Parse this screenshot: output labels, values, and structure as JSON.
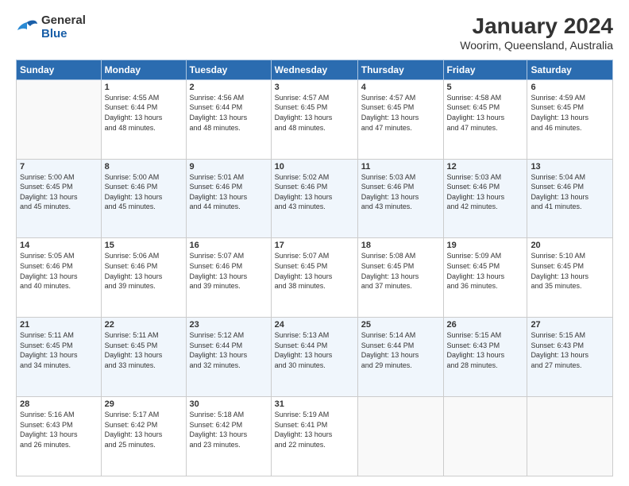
{
  "header": {
    "logo_general": "General",
    "logo_blue": "Blue",
    "title": "January 2024",
    "subtitle": "Woorim, Queensland, Australia"
  },
  "days_of_week": [
    "Sunday",
    "Monday",
    "Tuesday",
    "Wednesday",
    "Thursday",
    "Friday",
    "Saturday"
  ],
  "weeks": [
    [
      {
        "day": "",
        "info": ""
      },
      {
        "day": "1",
        "info": "Sunrise: 4:55 AM\nSunset: 6:44 PM\nDaylight: 13 hours\nand 48 minutes."
      },
      {
        "day": "2",
        "info": "Sunrise: 4:56 AM\nSunset: 6:44 PM\nDaylight: 13 hours\nand 48 minutes."
      },
      {
        "day": "3",
        "info": "Sunrise: 4:57 AM\nSunset: 6:45 PM\nDaylight: 13 hours\nand 48 minutes."
      },
      {
        "day": "4",
        "info": "Sunrise: 4:57 AM\nSunset: 6:45 PM\nDaylight: 13 hours\nand 47 minutes."
      },
      {
        "day": "5",
        "info": "Sunrise: 4:58 AM\nSunset: 6:45 PM\nDaylight: 13 hours\nand 47 minutes."
      },
      {
        "day": "6",
        "info": "Sunrise: 4:59 AM\nSunset: 6:45 PM\nDaylight: 13 hours\nand 46 minutes."
      }
    ],
    [
      {
        "day": "7",
        "info": "Sunrise: 5:00 AM\nSunset: 6:45 PM\nDaylight: 13 hours\nand 45 minutes."
      },
      {
        "day": "8",
        "info": "Sunrise: 5:00 AM\nSunset: 6:46 PM\nDaylight: 13 hours\nand 45 minutes."
      },
      {
        "day": "9",
        "info": "Sunrise: 5:01 AM\nSunset: 6:46 PM\nDaylight: 13 hours\nand 44 minutes."
      },
      {
        "day": "10",
        "info": "Sunrise: 5:02 AM\nSunset: 6:46 PM\nDaylight: 13 hours\nand 43 minutes."
      },
      {
        "day": "11",
        "info": "Sunrise: 5:03 AM\nSunset: 6:46 PM\nDaylight: 13 hours\nand 43 minutes."
      },
      {
        "day": "12",
        "info": "Sunrise: 5:03 AM\nSunset: 6:46 PM\nDaylight: 13 hours\nand 42 minutes."
      },
      {
        "day": "13",
        "info": "Sunrise: 5:04 AM\nSunset: 6:46 PM\nDaylight: 13 hours\nand 41 minutes."
      }
    ],
    [
      {
        "day": "14",
        "info": "Sunrise: 5:05 AM\nSunset: 6:46 PM\nDaylight: 13 hours\nand 40 minutes."
      },
      {
        "day": "15",
        "info": "Sunrise: 5:06 AM\nSunset: 6:46 PM\nDaylight: 13 hours\nand 39 minutes."
      },
      {
        "day": "16",
        "info": "Sunrise: 5:07 AM\nSunset: 6:46 PM\nDaylight: 13 hours\nand 39 minutes."
      },
      {
        "day": "17",
        "info": "Sunrise: 5:07 AM\nSunset: 6:45 PM\nDaylight: 13 hours\nand 38 minutes."
      },
      {
        "day": "18",
        "info": "Sunrise: 5:08 AM\nSunset: 6:45 PM\nDaylight: 13 hours\nand 37 minutes."
      },
      {
        "day": "19",
        "info": "Sunrise: 5:09 AM\nSunset: 6:45 PM\nDaylight: 13 hours\nand 36 minutes."
      },
      {
        "day": "20",
        "info": "Sunrise: 5:10 AM\nSunset: 6:45 PM\nDaylight: 13 hours\nand 35 minutes."
      }
    ],
    [
      {
        "day": "21",
        "info": "Sunrise: 5:11 AM\nSunset: 6:45 PM\nDaylight: 13 hours\nand 34 minutes."
      },
      {
        "day": "22",
        "info": "Sunrise: 5:11 AM\nSunset: 6:45 PM\nDaylight: 13 hours\nand 33 minutes."
      },
      {
        "day": "23",
        "info": "Sunrise: 5:12 AM\nSunset: 6:44 PM\nDaylight: 13 hours\nand 32 minutes."
      },
      {
        "day": "24",
        "info": "Sunrise: 5:13 AM\nSunset: 6:44 PM\nDaylight: 13 hours\nand 30 minutes."
      },
      {
        "day": "25",
        "info": "Sunrise: 5:14 AM\nSunset: 6:44 PM\nDaylight: 13 hours\nand 29 minutes."
      },
      {
        "day": "26",
        "info": "Sunrise: 5:15 AM\nSunset: 6:43 PM\nDaylight: 13 hours\nand 28 minutes."
      },
      {
        "day": "27",
        "info": "Sunrise: 5:15 AM\nSunset: 6:43 PM\nDaylight: 13 hours\nand 27 minutes."
      }
    ],
    [
      {
        "day": "28",
        "info": "Sunrise: 5:16 AM\nSunset: 6:43 PM\nDaylight: 13 hours\nand 26 minutes."
      },
      {
        "day": "29",
        "info": "Sunrise: 5:17 AM\nSunset: 6:42 PM\nDaylight: 13 hours\nand 25 minutes."
      },
      {
        "day": "30",
        "info": "Sunrise: 5:18 AM\nSunset: 6:42 PM\nDaylight: 13 hours\nand 23 minutes."
      },
      {
        "day": "31",
        "info": "Sunrise: 5:19 AM\nSunset: 6:41 PM\nDaylight: 13 hours\nand 22 minutes."
      },
      {
        "day": "",
        "info": ""
      },
      {
        "day": "",
        "info": ""
      },
      {
        "day": "",
        "info": ""
      }
    ]
  ]
}
